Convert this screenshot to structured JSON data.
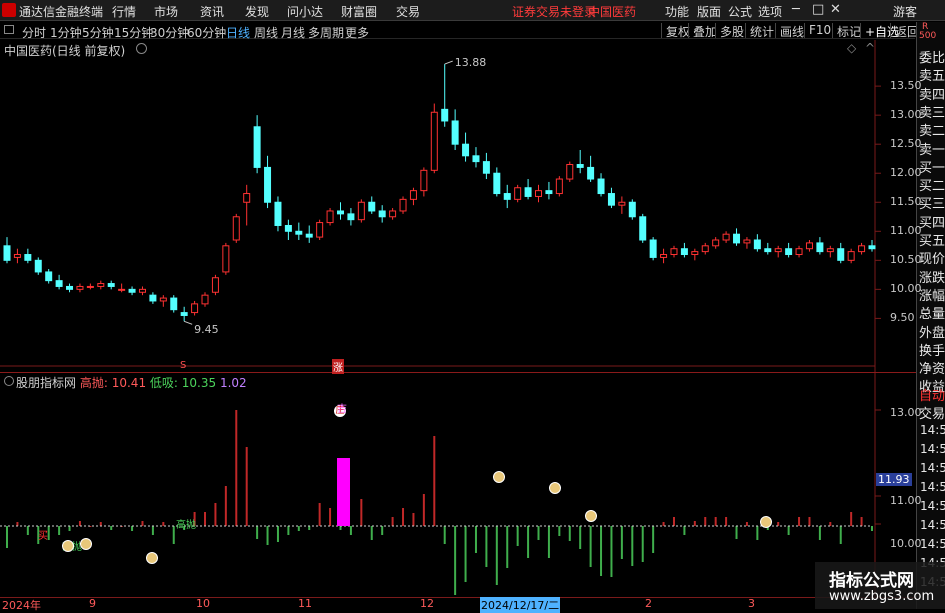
{
  "app": {
    "title": "通达信金融终端",
    "menu": [
      "行情",
      "市场",
      "资讯",
      "发现",
      "问小达",
      "财富圈",
      "交易"
    ],
    "warning": "证券交易未登录",
    "stock": "中国医药",
    "right_menu": [
      "功能",
      "版面",
      "公式",
      "选项"
    ],
    "guest": "游客",
    "controls": [
      "─",
      "□",
      "✕"
    ]
  },
  "periods": [
    "分时",
    "1分钟",
    "5分钟",
    "15分钟",
    "30分钟",
    "60分钟",
    "日线",
    "周线",
    "月线",
    "多周期",
    "更多"
  ],
  "toolbar": [
    "复权",
    "叠加",
    "多股",
    "统计",
    "画线",
    "F10",
    "标记",
    "+自选",
    "返回"
  ],
  "chart_title": "中国医药(日线 前复权)",
  "price_axis": [
    "13.50",
    "13.00",
    "12.50",
    "12.00",
    "11.50",
    "11.00",
    "10.50",
    "10.00",
    "9.50"
  ],
  "annotations": {
    "high": "13.88",
    "low": "9.45",
    "mark_s": "S",
    "mark_zhang": "涨"
  },
  "indicator": {
    "name": "股朋指标网",
    "k1": "高抛:",
    "v1": "10.41",
    "k2": "低吸:",
    "v2": "10.35",
    "v3": "1.02",
    "axis": [
      "13.00",
      "11.00",
      "10.00"
    ],
    "current": "11.93",
    "tag_buy": "买",
    "tag_gaopao": "高抛",
    "tag_gaopao2": "高抛",
    "tag_ji": "吉",
    "tag_zhuang": "庄"
  },
  "dates": [
    "2024年",
    "9",
    "10",
    "11",
    "12",
    "2024/12/17/二",
    "2",
    "3"
  ],
  "side": {
    "r_label": "R",
    "r_num": "500",
    "rows1": [
      "委比",
      "卖五",
      "卖四",
      "卖三",
      "卖二",
      "卖一",
      "买一",
      "买二",
      "买三",
      "买四",
      "买五",
      "现价",
      "涨跌",
      "涨幅",
      "总量",
      "外盘",
      "换手",
      "净资",
      "收益"
    ],
    "rows2": [
      "自动",
      "交易"
    ],
    "times": [
      "14:5",
      "14:5",
      "14:5",
      "14:5",
      "14:5",
      "14:5",
      "14:5",
      "14:5",
      "14:5"
    ]
  },
  "watermark": {
    "title": "指标公式网",
    "url": "www.zbgs3.com"
  },
  "colors": {
    "up": "#ff3232",
    "down": "#54ffff",
    "magenta": "#ff00ff",
    "green": "#4cd45c",
    "blue": "#4fb2ff"
  },
  "chart_data": {
    "type": "candlestick",
    "yaxis": [
      9.3,
      13.95
    ],
    "price_high": 13.88,
    "price_low": 9.45,
    "candles": [
      [
        10.75,
        10.9,
        10.45,
        10.5
      ],
      [
        10.55,
        10.7,
        10.45,
        10.6
      ],
      [
        10.6,
        10.7,
        10.45,
        10.5
      ],
      [
        10.5,
        10.55,
        10.25,
        10.3
      ],
      [
        10.3,
        10.35,
        10.1,
        10.15
      ],
      [
        10.15,
        10.25,
        10.0,
        10.05
      ],
      [
        10.05,
        10.1,
        9.95,
        10.0
      ],
      [
        10.0,
        10.1,
        9.95,
        10.05
      ],
      [
        10.05,
        10.1,
        10.0,
        10.05
      ],
      [
        10.05,
        10.15,
        10.0,
        10.1
      ],
      [
        10.1,
        10.15,
        10.0,
        10.05
      ],
      [
        10.0,
        10.1,
        9.95,
        10.0
      ],
      [
        10.0,
        10.05,
        9.9,
        9.95
      ],
      [
        9.95,
        10.05,
        9.9,
        10.0
      ],
      [
        9.9,
        9.95,
        9.75,
        9.8
      ],
      [
        9.8,
        9.9,
        9.7,
        9.85
      ],
      [
        9.85,
        9.9,
        9.6,
        9.65
      ],
      [
        9.6,
        9.7,
        9.45,
        9.55
      ],
      [
        9.6,
        9.8,
        9.55,
        9.75
      ],
      [
        9.75,
        9.95,
        9.7,
        9.9
      ],
      [
        9.95,
        10.25,
        9.9,
        10.2
      ],
      [
        10.3,
        10.8,
        10.25,
        10.75
      ],
      [
        10.85,
        11.3,
        10.8,
        11.25
      ],
      [
        11.5,
        11.8,
        11.1,
        11.65
      ],
      [
        12.8,
        13.0,
        12.0,
        12.1
      ],
      [
        12.1,
        12.3,
        11.4,
        11.5
      ],
      [
        11.5,
        11.6,
        11.0,
        11.1
      ],
      [
        11.1,
        11.2,
        10.85,
        11.0
      ],
      [
        11.0,
        11.15,
        10.85,
        10.95
      ],
      [
        10.95,
        11.1,
        10.8,
        10.9
      ],
      [
        10.9,
        11.2,
        10.85,
        11.15
      ],
      [
        11.15,
        11.4,
        11.1,
        11.35
      ],
      [
        11.35,
        11.5,
        11.2,
        11.3
      ],
      [
        11.3,
        11.4,
        11.1,
        11.2
      ],
      [
        11.2,
        11.55,
        11.15,
        11.5
      ],
      [
        11.5,
        11.6,
        11.3,
        11.35
      ],
      [
        11.35,
        11.45,
        11.15,
        11.25
      ],
      [
        11.25,
        11.4,
        11.2,
        11.35
      ],
      [
        11.35,
        11.6,
        11.3,
        11.55
      ],
      [
        11.55,
        11.75,
        11.45,
        11.7
      ],
      [
        11.7,
        12.1,
        11.6,
        12.05
      ],
      [
        12.05,
        13.2,
        12.0,
        13.05
      ],
      [
        13.1,
        13.88,
        12.8,
        12.9
      ],
      [
        12.9,
        13.1,
        12.4,
        12.5
      ],
      [
        12.5,
        12.7,
        12.2,
        12.3
      ],
      [
        12.3,
        12.45,
        12.1,
        12.2
      ],
      [
        12.2,
        12.35,
        11.9,
        12.0
      ],
      [
        12.0,
        12.1,
        11.6,
        11.65
      ],
      [
        11.65,
        11.8,
        11.4,
        11.55
      ],
      [
        11.55,
        11.8,
        11.5,
        11.75
      ],
      [
        11.75,
        11.9,
        11.55,
        11.6
      ],
      [
        11.6,
        11.8,
        11.5,
        11.7
      ],
      [
        11.7,
        11.85,
        11.55,
        11.65
      ],
      [
        11.65,
        11.95,
        11.6,
        11.9
      ],
      [
        11.9,
        12.2,
        11.85,
        12.15
      ],
      [
        12.15,
        12.4,
        12.0,
        12.1
      ],
      [
        12.1,
        12.3,
        11.85,
        11.9
      ],
      [
        11.9,
        12.0,
        11.6,
        11.65
      ],
      [
        11.65,
        11.75,
        11.4,
        11.45
      ],
      [
        11.45,
        11.6,
        11.3,
        11.5
      ],
      [
        11.5,
        11.55,
        11.2,
        11.25
      ],
      [
        11.25,
        11.3,
        10.8,
        10.85
      ],
      [
        10.85,
        10.9,
        10.5,
        10.55
      ],
      [
        10.55,
        10.7,
        10.45,
        10.6
      ],
      [
        10.6,
        10.75,
        10.55,
        10.7
      ],
      [
        10.7,
        10.8,
        10.55,
        10.6
      ],
      [
        10.6,
        10.7,
        10.5,
        10.65
      ],
      [
        10.65,
        10.8,
        10.6,
        10.75
      ],
      [
        10.75,
        10.9,
        10.7,
        10.85
      ],
      [
        10.85,
        11.0,
        10.8,
        10.95
      ],
      [
        10.95,
        11.05,
        10.75,
        10.8
      ],
      [
        10.8,
        10.9,
        10.7,
        10.85
      ],
      [
        10.85,
        10.95,
        10.65,
        10.7
      ],
      [
        10.7,
        10.8,
        10.6,
        10.65
      ],
      [
        10.65,
        10.75,
        10.55,
        10.7
      ],
      [
        10.7,
        10.8,
        10.55,
        10.6
      ],
      [
        10.6,
        10.75,
        10.55,
        10.7
      ],
      [
        10.7,
        10.85,
        10.65,
        10.8
      ],
      [
        10.8,
        10.9,
        10.6,
        10.65
      ],
      [
        10.65,
        10.75,
        10.55,
        10.7
      ],
      [
        10.7,
        10.8,
        10.45,
        10.5
      ],
      [
        10.5,
        10.7,
        10.45,
        10.65
      ],
      [
        10.65,
        10.8,
        10.6,
        10.75
      ],
      [
        10.75,
        10.85,
        10.65,
        10.7
      ]
    ]
  }
}
